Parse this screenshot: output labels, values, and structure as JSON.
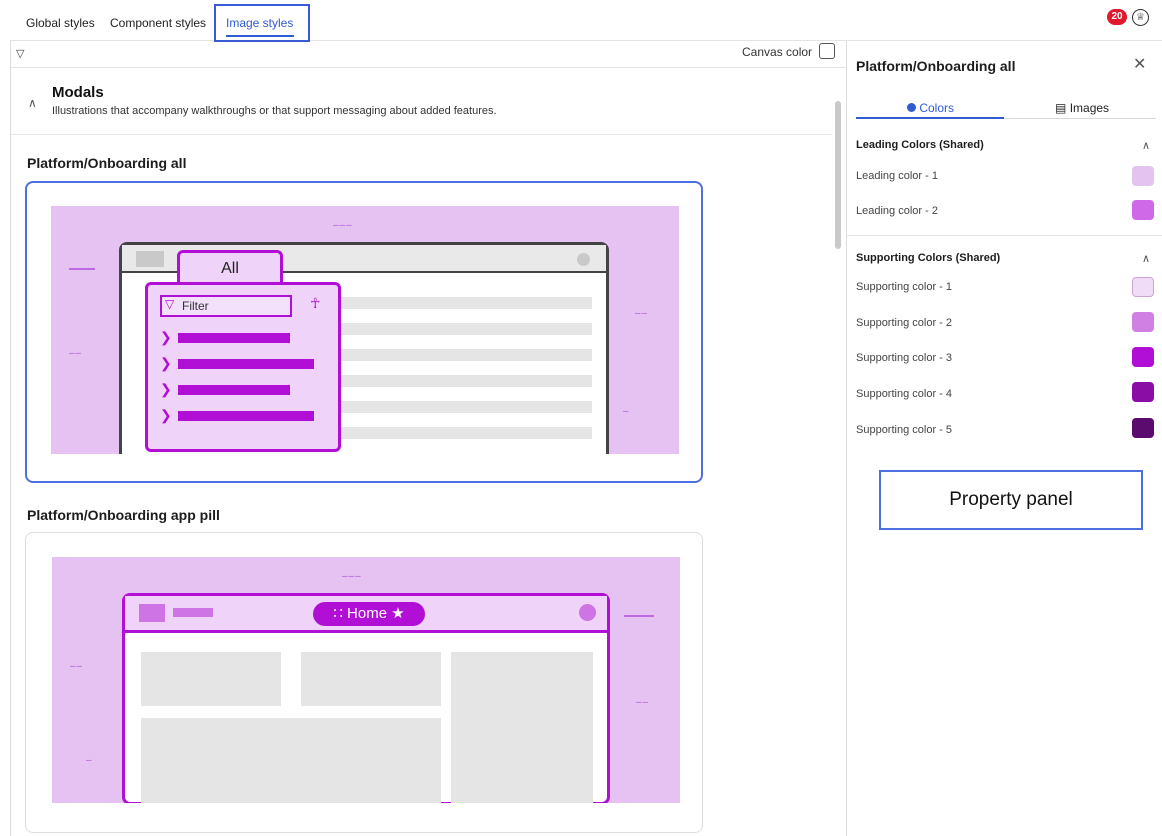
{
  "top_tabs": [
    "Global styles",
    "Component styles",
    "Image styles"
  ],
  "notification_count": "20",
  "canvas_color_label": "Canvas color",
  "modals": {
    "title": "Modals",
    "description": "Illustrations that accompany walkthroughs or that support messaging about added features."
  },
  "sections": [
    {
      "title": "Platform/Onboarding all"
    },
    {
      "title": "Platform/Onboarding app pill"
    }
  ],
  "illustration1": {
    "tab_label": "All",
    "filter_label": "Filter"
  },
  "illustration2": {
    "pill_label": "Home"
  },
  "panel": {
    "title": "Platform/Onboarding all",
    "tabs": [
      "Colors",
      "Images"
    ],
    "leading_title": "Leading Colors (Shared)",
    "leading": [
      {
        "label": "Leading color - 1",
        "color": "#e4c3f1"
      },
      {
        "label": "Leading color - 2",
        "color": "#d069e8"
      }
    ],
    "supporting_title": "Supporting Colors (Shared)",
    "supporting": [
      {
        "label": "Supporting color - 1",
        "color": "#f1dcf7"
      },
      {
        "label": "Supporting color - 2",
        "color": "#d07fe2"
      },
      {
        "label": "Supporting color - 3",
        "color": "#b10fd6"
      },
      {
        "label": "Supporting color - 4",
        "color": "#8a0ea6"
      },
      {
        "label": "Supporting color - 5",
        "color": "#5b0a6d"
      }
    ]
  },
  "callout_label": "Property panel",
  "colors": {
    "accent": "#2f5bd3",
    "brand_purple": "#b10fd6",
    "illustration_bg": "#e5c2f1"
  }
}
